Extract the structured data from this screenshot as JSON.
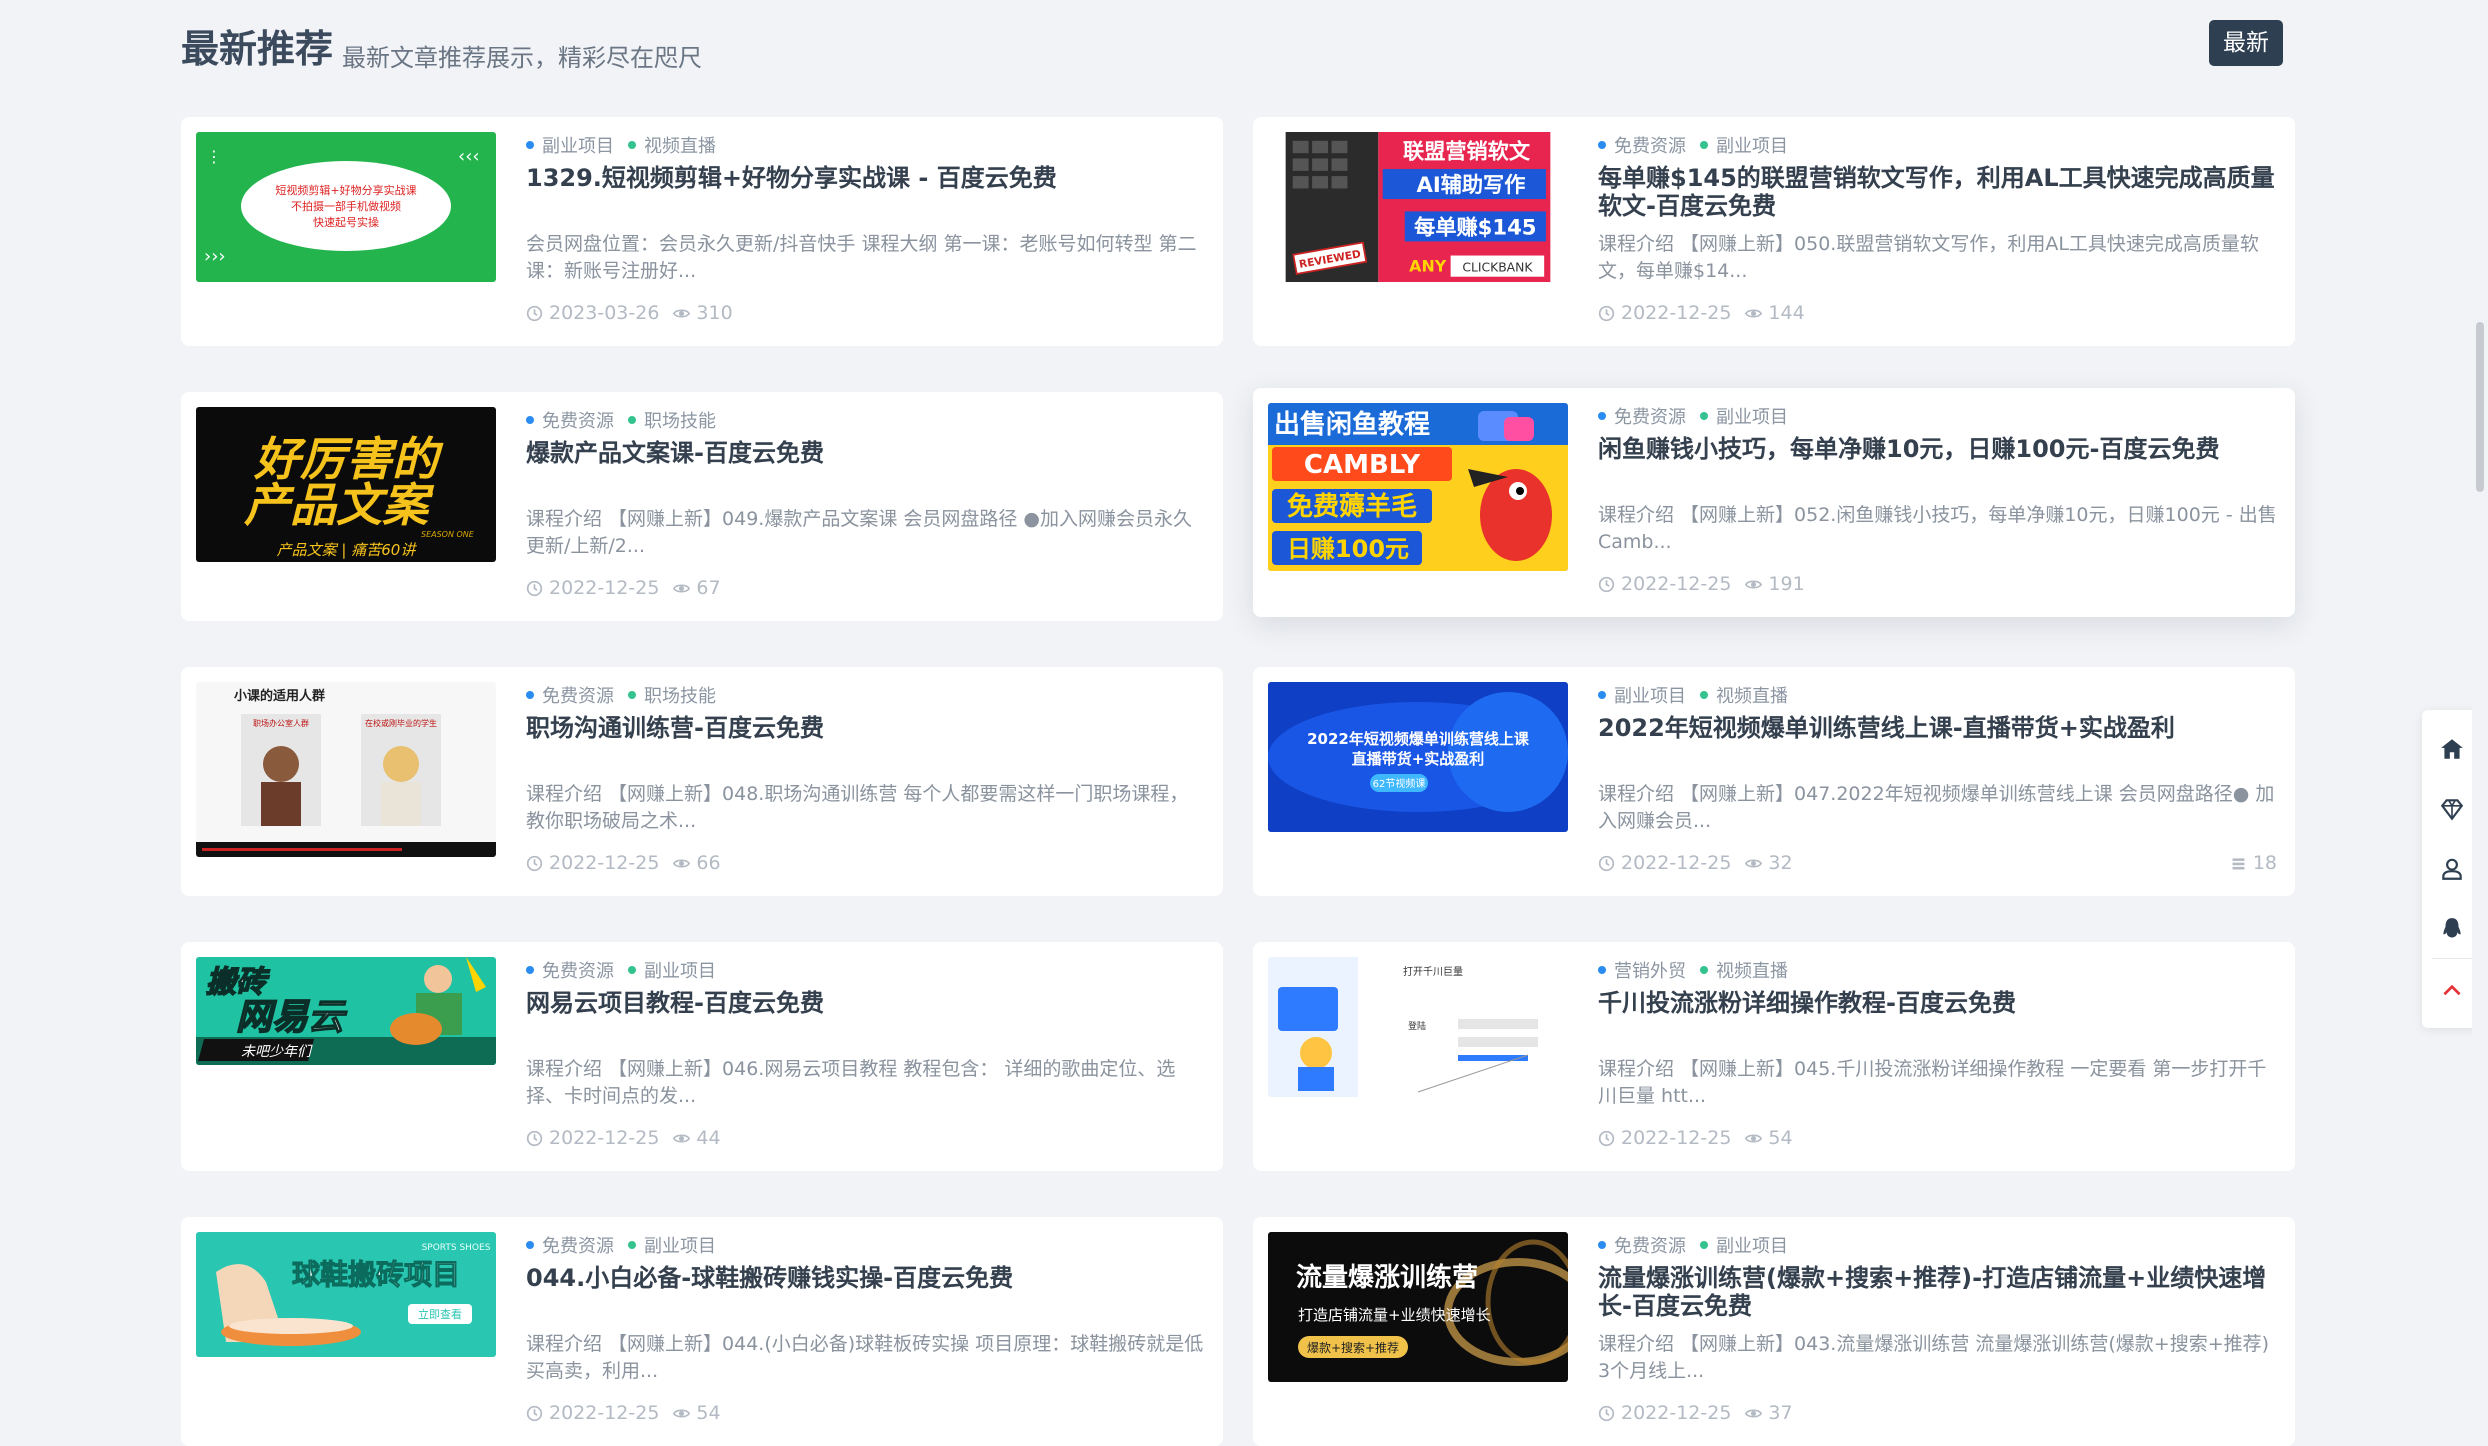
{
  "section": {
    "title": "最新推荐",
    "subtitle": "最新文章推荐展示，精彩尽在咫尺",
    "badge": "最新"
  },
  "colors": {
    "tag_dot_blue": "#2a8cf0",
    "tag_dot_green": "#34c38f",
    "badge_bg": "#2f3f52"
  },
  "cards": [
    {
      "tags": [
        "副业项目",
        "视频直播"
      ],
      "title": "1329.短视频剪辑+好物分享实战课 - 百度云免费",
      "excerpt": "会员网盘位置：会员永久更新/抖音快手 课程大纲 第一课：老账号如何转型 第二课：新账号注册好...",
      "date": "2023-03-26",
      "views": "310",
      "thumb_text": [
        "短视频剪辑+好物分享实战课",
        "不拍摄一部手机做视频",
        "快速起号实操"
      ]
    },
    {
      "tags": [
        "免费资源",
        "副业项目"
      ],
      "title": "每单赚$145的联盟营销软文写作，利用AL工具快速完成高质量软文-百度云免费",
      "excerpt": "课程介绍 【网赚上新】050.联盟营销软文写作，利用AL工具快速完成高质量软文，每单赚$14...",
      "date": "2022-12-25",
      "views": "144",
      "thumb_text": [
        "联盟营销软文",
        "AI辅助写作",
        "每单赚$145",
        "REVIEWED",
        "ANY",
        "CLICKBANK"
      ]
    },
    {
      "tags": [
        "免费资源",
        "职场技能"
      ],
      "title": "爆款产品文案课-百度云免费",
      "excerpt": "课程介绍 【网赚上新】049.爆款产品文案课 会员网盘路径 ●加入网赚会员永久更新/上新/2...",
      "date": "2022-12-25",
      "views": "67",
      "thumb_text": [
        "好厉害的",
        "产品文案",
        "SEASON ONE",
        "产品文案 | 痛苦60讲"
      ]
    },
    {
      "tags": [
        "免费资源",
        "副业项目"
      ],
      "title": "闲鱼赚钱小技巧，每单净赚10元，日赚100元-百度云免费",
      "excerpt": "课程介绍 【网赚上新】052.闲鱼赚钱小技巧，每单净赚10元，日赚100元 - 出售Camb...",
      "date": "2022-12-25",
      "views": "191",
      "thumb_text": [
        "出售闲鱼教程",
        "CAMBLY",
        "免费薅羊毛",
        "日赚100元"
      ]
    },
    {
      "tags": [
        "免费资源",
        "职场技能"
      ],
      "title": "职场沟通训练营-百度云免费",
      "excerpt": "课程介绍 【网赚上新】048.职场沟通训练营 每个人都要需这样一门职场课程，教你职场破局之术...",
      "date": "2022-12-25",
      "views": "66",
      "thumb_text": [
        "小课的适用人群",
        "职场办公室人群",
        "在校或刚毕业的学生"
      ]
    },
    {
      "tags": [
        "副业项目",
        "视频直播"
      ],
      "title": "2022年短视频爆单训练营线上课-直播带货+实战盈利",
      "excerpt": "课程介绍 【网赚上新】047.2022年短视频爆单训练营线上课 会员网盘路径● 加入网赚会员...",
      "date": "2022-12-25",
      "views": "32",
      "comments": "18",
      "thumb_text": [
        "2022年短视频爆单训练营线上课",
        "直播带货+实战盈利",
        "62节视频课"
      ]
    },
    {
      "tags": [
        "免费资源",
        "副业项目"
      ],
      "title": "网易云项目教程-百度云免费",
      "excerpt": "课程介绍 【网赚上新】046.网易云项目教程 教程包含： 详细的歌曲定位、选择、卡时间点的发...",
      "date": "2022-12-25",
      "views": "44",
      "thumb_text": [
        "搬砖",
        "网易云",
        "未吧少年们"
      ]
    },
    {
      "tags": [
        "营销外贸",
        "视频直播"
      ],
      "title": "千川投流涨粉详细操作教程-百度云免费",
      "excerpt": "课程介绍 【网赚上新】045.千川投流涨粉详细操作教程 一定要看 第一步打开千川巨量 htt...",
      "date": "2022-12-25",
      "views": "54",
      "thumb_text": [
        "打开千川巨量",
        "登陆"
      ]
    },
    {
      "tags": [
        "免费资源",
        "副业项目"
      ],
      "title": "044.小白必备-球鞋搬砖赚钱实操-百度云免费",
      "excerpt": "课程介绍 【网赚上新】044.(小白必备)球鞋板砖实操 项目原理：球鞋搬砖就是低买高卖，利用...",
      "date": "2022-12-25",
      "views": "54",
      "thumb_text": [
        "SPORTS SHOES",
        "球鞋搬砖项目",
        "立即查看"
      ]
    },
    {
      "tags": [
        "免费资源",
        "副业项目"
      ],
      "title": "流量爆涨训练营(爆款+搜索+推荐)-打造店铺流量+业绩快速增长-百度云免费",
      "excerpt": "课程介绍 【网赚上新】043.流量爆涨训练营 流量爆涨训练营(爆款+搜索+推荐) 3个月线上...",
      "date": "2022-12-25",
      "views": "37",
      "thumb_text": [
        "流量爆涨训练营",
        "打造店铺流量+业绩快速增长",
        "爆款+搜索+推荐"
      ]
    }
  ],
  "sidebar": {
    "icons": [
      "home-icon",
      "diamond-icon",
      "user-icon",
      "qq-icon",
      "chevron-up-icon"
    ]
  }
}
